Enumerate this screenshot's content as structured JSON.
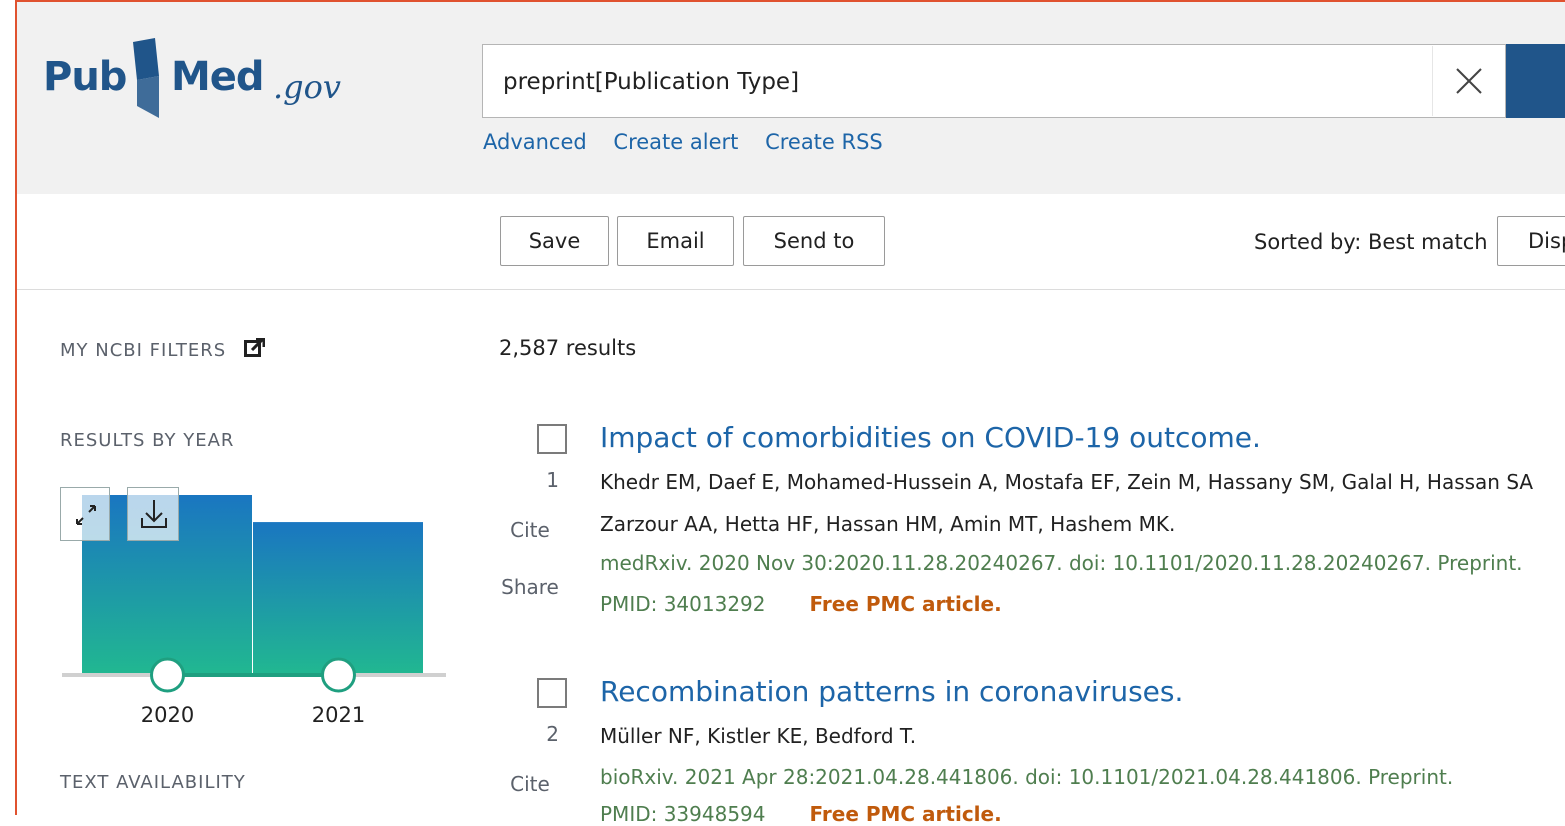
{
  "brand": {
    "pub": "Pub",
    "med": "Med",
    "gov": ".gov"
  },
  "search": {
    "value": "preprint[Publication Type]",
    "links": [
      "Advanced",
      "Create alert",
      "Create RSS"
    ]
  },
  "toolbar": {
    "save": "Save",
    "email": "Email",
    "send_to": "Send to",
    "sorted": "Sorted by: Best match",
    "display": "Disp"
  },
  "sidebar": {
    "my_filters": "MY NCBI FILTERS",
    "results_by_year": "RESULTS BY YEAR",
    "text_availability": "TEXT AVAILABILITY"
  },
  "chart_data": {
    "type": "bar",
    "categories": [
      "2020",
      "2021"
    ],
    "values": [
      1400,
      1187
    ],
    "ylim": [
      0,
      1400
    ],
    "colors": [
      "#1a76c1",
      "#21b791"
    ],
    "slider_range": [
      "2020",
      "2021"
    ]
  },
  "results": {
    "count": "2,587 results",
    "items": [
      {
        "num": "1",
        "title": "Impact of comorbidities on COVID-19 outcome.",
        "authors1": "Khedr EM, Daef E, Mohamed-Hussein A, Mostafa EF, Zein M, Hassany SM, Galal H, Hassan SA",
        "authors2": "Zarzour AA, Hetta HF, Hassan HM, Amin MT, Hashem MK.",
        "journal": "medRxiv. 2020 Nov 30:2020.11.28.20240267. doi: 10.1101/2020.11.28.20240267. Preprint.",
        "pmid": "PMID: 34013292",
        "free": "Free PMC article.",
        "cite": "Cite",
        "share": "Share"
      },
      {
        "num": "2",
        "title": "Recombination patterns in coronaviruses.",
        "authors1": "Müller NF, Kistler KE, Bedford T.",
        "journal": "bioRxiv. 2021 Apr 28:2021.04.28.441806. doi: 10.1101/2021.04.28.441806. Preprint.",
        "pmid": "PMID: 33948594",
        "free": "Free PMC article.",
        "cite": "Cite"
      }
    ]
  }
}
